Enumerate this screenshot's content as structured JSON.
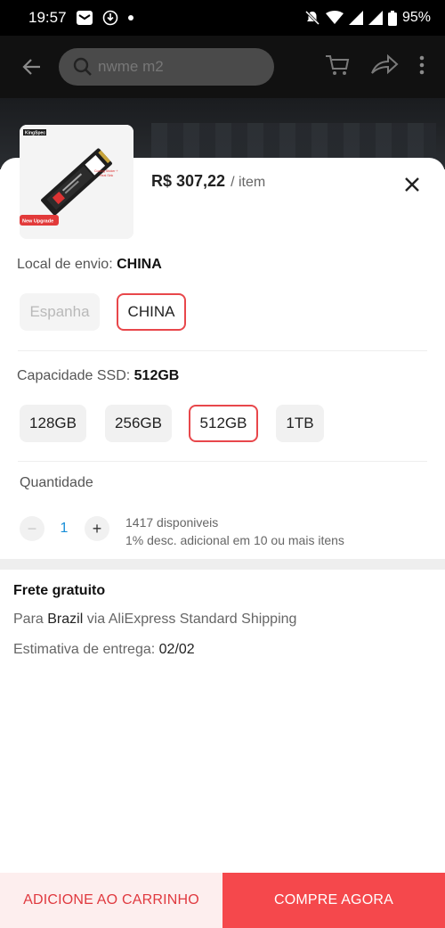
{
  "status_bar": {
    "time": "19:57",
    "battery": "95%"
  },
  "search": {
    "query": "nwme m2"
  },
  "product": {
    "price": "R$ 307,22",
    "price_unit": "/ item",
    "thumb_brand": "KingSpec",
    "thumb_badge": "New Upgrade",
    "thumb_callout": "Cooling Sticker + Heat Sink",
    "thumb_label": "M.2 · 128GB · NVMe"
  },
  "shipping_origin": {
    "label": "Local de envio:",
    "selected": "CHINA",
    "options": [
      "Espanha",
      "CHINA"
    ]
  },
  "capacity": {
    "label": "Capacidade SSD:",
    "selected": "512GB",
    "options": [
      "128GB",
      "256GB",
      "512GB",
      "1TB"
    ]
  },
  "quantity": {
    "label": "Quantidade",
    "value": "1",
    "minus": "−",
    "plus": "+",
    "stock": "1417 disponiveis",
    "discount": "1% desc. adicional em 10 ou mais itens"
  },
  "shipping": {
    "title": "Frete gratuito",
    "to_prefix": "Para",
    "country": "Brazil",
    "via": "via AliExpress Standard Shipping",
    "estimate_label": "Estimativa de entrega:",
    "estimate_date": "02/02"
  },
  "actions": {
    "add_to_cart": "ADICIONE AO CARRINHO",
    "buy_now": "COMPRE AGORA"
  },
  "colors": {
    "accent": "#f5484c",
    "accent_light": "#fdeeee",
    "quantity_text": "#1a8fd8"
  }
}
